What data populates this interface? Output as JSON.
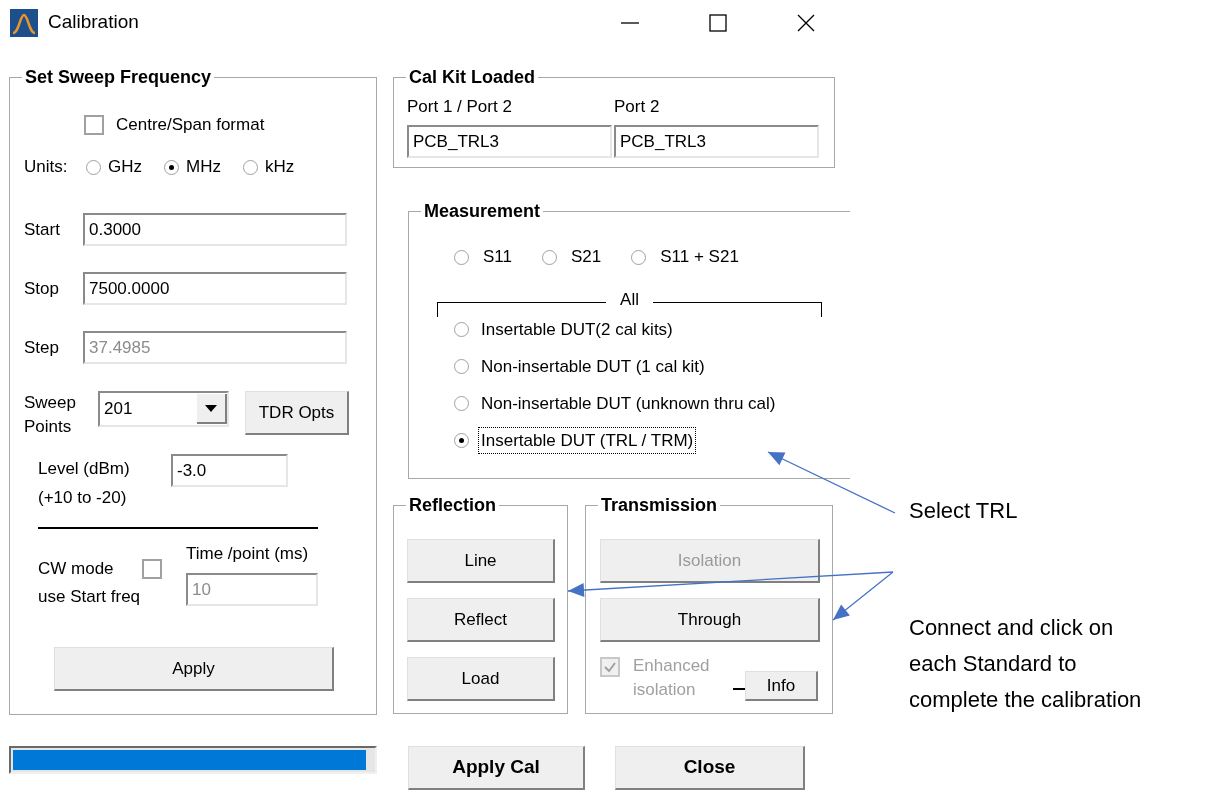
{
  "window": {
    "title": "Calibration"
  },
  "sweep": {
    "title": "Set Sweep Frequency",
    "centre_span": {
      "label": "Centre/Span format",
      "checked": false
    },
    "units_label": "Units:",
    "units": [
      {
        "label": "GHz",
        "selected": false
      },
      {
        "label": "MHz",
        "selected": true
      },
      {
        "label": "kHz",
        "selected": false
      }
    ],
    "fields": [
      {
        "label": "Start",
        "value": "0.3000",
        "disabled": false
      },
      {
        "label": "Stop",
        "value": "7500.0000",
        "disabled": false
      },
      {
        "label": "Step",
        "value": "37.4985",
        "disabled": true
      }
    ],
    "sweep_points": {
      "label": "Sweep Points",
      "value": "201"
    },
    "tdr_button": "TDR Opts",
    "level": {
      "label": "Level (dBm)",
      "range": "(+10 to -20)",
      "value": "-3.0"
    },
    "cw_mode": {
      "label": "CW mode",
      "sublabel": "use Start freq",
      "checked": false
    },
    "time_per_point": {
      "label": "Time /point (ms)",
      "value": "10",
      "disabled": true
    },
    "apply_button": "Apply"
  },
  "progress": {
    "level": 0.98
  },
  "cal_kit": {
    "title": "Cal Kit Loaded",
    "ports": [
      {
        "label": "Port 1 / Port 2",
        "value": "PCB_TRL3"
      },
      {
        "label": "Port 2",
        "value": "PCB_TRL3"
      }
    ]
  },
  "measurement": {
    "title": "Measurement",
    "params": [
      {
        "label": "S11",
        "selected": false
      },
      {
        "label": "S21",
        "selected": false
      },
      {
        "label": "S11 + S21",
        "selected": false
      }
    ],
    "group_label": "All",
    "modes": [
      {
        "label": "Insertable DUT(2 cal kits)",
        "selected": false
      },
      {
        "label": "Non-insertable DUT (1 cal kit)",
        "selected": false
      },
      {
        "label": "Non-insertable DUT (unknown thru cal)",
        "selected": false
      },
      {
        "label": "Insertable DUT (TRL / TRM)",
        "selected": true
      }
    ]
  },
  "reflection": {
    "title": "Reflection",
    "buttons": [
      {
        "label": "Line",
        "disabled": false
      },
      {
        "label": "Reflect",
        "disabled": false
      },
      {
        "label": "Load",
        "disabled": false
      }
    ]
  },
  "transmission": {
    "title": "Transmission",
    "buttons": [
      {
        "label": "Isolation",
        "disabled": true
      },
      {
        "label": "Through",
        "disabled": false
      }
    ],
    "enhanced_isolation": {
      "label": "Enhanced isolation",
      "checked": true,
      "disabled": true
    },
    "info_button": "Info"
  },
  "footer_buttons": [
    "Apply Cal",
    "Close"
  ],
  "annotations": [
    {
      "lines": [
        "Select TRL"
      ]
    },
    {
      "lines": [
        "Connect and click on",
        "each Standard to",
        "complete the calibration"
      ]
    }
  ]
}
